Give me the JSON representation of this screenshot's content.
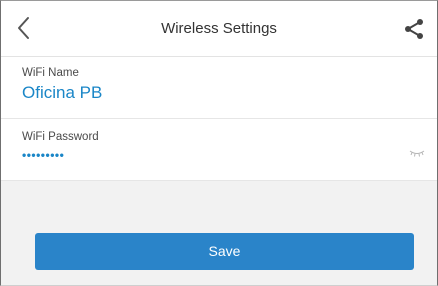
{
  "header": {
    "title": "Wireless Settings",
    "back_icon": "chevron-left-icon",
    "share_icon": "share-icon"
  },
  "form": {
    "wifi_name_label": "WiFi Name",
    "wifi_name_value": "Oficina PB",
    "wifi_password_label": "WiFi Password",
    "wifi_password_value": "•••••••••",
    "password_toggle_icon": "eye-closed-icon"
  },
  "actions": {
    "save_label": "Save"
  },
  "colors": {
    "accent": "#1a86c7",
    "button": "#2a84c9",
    "background": "#f2f2f2"
  }
}
